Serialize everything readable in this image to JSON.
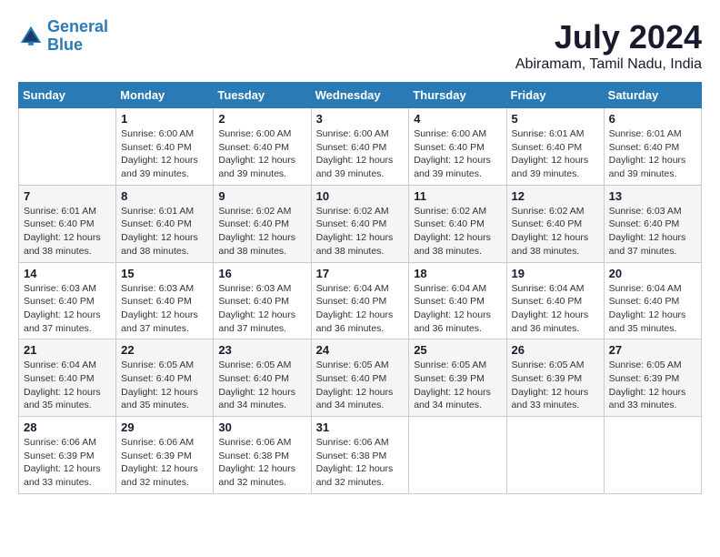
{
  "header": {
    "logo_line1": "General",
    "logo_line2": "Blue",
    "month_year": "July 2024",
    "location": "Abiramam, Tamil Nadu, India"
  },
  "calendar": {
    "days_of_week": [
      "Sunday",
      "Monday",
      "Tuesday",
      "Wednesday",
      "Thursday",
      "Friday",
      "Saturday"
    ],
    "weeks": [
      [
        {
          "day": "",
          "info": ""
        },
        {
          "day": "1",
          "info": "Sunrise: 6:00 AM\nSunset: 6:40 PM\nDaylight: 12 hours\nand 39 minutes."
        },
        {
          "day": "2",
          "info": "Sunrise: 6:00 AM\nSunset: 6:40 PM\nDaylight: 12 hours\nand 39 minutes."
        },
        {
          "day": "3",
          "info": "Sunrise: 6:00 AM\nSunset: 6:40 PM\nDaylight: 12 hours\nand 39 minutes."
        },
        {
          "day": "4",
          "info": "Sunrise: 6:00 AM\nSunset: 6:40 PM\nDaylight: 12 hours\nand 39 minutes."
        },
        {
          "day": "5",
          "info": "Sunrise: 6:01 AM\nSunset: 6:40 PM\nDaylight: 12 hours\nand 39 minutes."
        },
        {
          "day": "6",
          "info": "Sunrise: 6:01 AM\nSunset: 6:40 PM\nDaylight: 12 hours\nand 39 minutes."
        }
      ],
      [
        {
          "day": "7",
          "info": "Sunrise: 6:01 AM\nSunset: 6:40 PM\nDaylight: 12 hours\nand 38 minutes."
        },
        {
          "day": "8",
          "info": "Sunrise: 6:01 AM\nSunset: 6:40 PM\nDaylight: 12 hours\nand 38 minutes."
        },
        {
          "day": "9",
          "info": "Sunrise: 6:02 AM\nSunset: 6:40 PM\nDaylight: 12 hours\nand 38 minutes."
        },
        {
          "day": "10",
          "info": "Sunrise: 6:02 AM\nSunset: 6:40 PM\nDaylight: 12 hours\nand 38 minutes."
        },
        {
          "day": "11",
          "info": "Sunrise: 6:02 AM\nSunset: 6:40 PM\nDaylight: 12 hours\nand 38 minutes."
        },
        {
          "day": "12",
          "info": "Sunrise: 6:02 AM\nSunset: 6:40 PM\nDaylight: 12 hours\nand 38 minutes."
        },
        {
          "day": "13",
          "info": "Sunrise: 6:03 AM\nSunset: 6:40 PM\nDaylight: 12 hours\nand 37 minutes."
        }
      ],
      [
        {
          "day": "14",
          "info": "Sunrise: 6:03 AM\nSunset: 6:40 PM\nDaylight: 12 hours\nand 37 minutes."
        },
        {
          "day": "15",
          "info": "Sunrise: 6:03 AM\nSunset: 6:40 PM\nDaylight: 12 hours\nand 37 minutes."
        },
        {
          "day": "16",
          "info": "Sunrise: 6:03 AM\nSunset: 6:40 PM\nDaylight: 12 hours\nand 37 minutes."
        },
        {
          "day": "17",
          "info": "Sunrise: 6:04 AM\nSunset: 6:40 PM\nDaylight: 12 hours\nand 36 minutes."
        },
        {
          "day": "18",
          "info": "Sunrise: 6:04 AM\nSunset: 6:40 PM\nDaylight: 12 hours\nand 36 minutes."
        },
        {
          "day": "19",
          "info": "Sunrise: 6:04 AM\nSunset: 6:40 PM\nDaylight: 12 hours\nand 36 minutes."
        },
        {
          "day": "20",
          "info": "Sunrise: 6:04 AM\nSunset: 6:40 PM\nDaylight: 12 hours\nand 35 minutes."
        }
      ],
      [
        {
          "day": "21",
          "info": "Sunrise: 6:04 AM\nSunset: 6:40 PM\nDaylight: 12 hours\nand 35 minutes."
        },
        {
          "day": "22",
          "info": "Sunrise: 6:05 AM\nSunset: 6:40 PM\nDaylight: 12 hours\nand 35 minutes."
        },
        {
          "day": "23",
          "info": "Sunrise: 6:05 AM\nSunset: 6:40 PM\nDaylight: 12 hours\nand 34 minutes."
        },
        {
          "day": "24",
          "info": "Sunrise: 6:05 AM\nSunset: 6:40 PM\nDaylight: 12 hours\nand 34 minutes."
        },
        {
          "day": "25",
          "info": "Sunrise: 6:05 AM\nSunset: 6:39 PM\nDaylight: 12 hours\nand 34 minutes."
        },
        {
          "day": "26",
          "info": "Sunrise: 6:05 AM\nSunset: 6:39 PM\nDaylight: 12 hours\nand 33 minutes."
        },
        {
          "day": "27",
          "info": "Sunrise: 6:05 AM\nSunset: 6:39 PM\nDaylight: 12 hours\nand 33 minutes."
        }
      ],
      [
        {
          "day": "28",
          "info": "Sunrise: 6:06 AM\nSunset: 6:39 PM\nDaylight: 12 hours\nand 33 minutes."
        },
        {
          "day": "29",
          "info": "Sunrise: 6:06 AM\nSunset: 6:39 PM\nDaylight: 12 hours\nand 32 minutes."
        },
        {
          "day": "30",
          "info": "Sunrise: 6:06 AM\nSunset: 6:38 PM\nDaylight: 12 hours\nand 32 minutes."
        },
        {
          "day": "31",
          "info": "Sunrise: 6:06 AM\nSunset: 6:38 PM\nDaylight: 12 hours\nand 32 minutes."
        },
        {
          "day": "",
          "info": ""
        },
        {
          "day": "",
          "info": ""
        },
        {
          "day": "",
          "info": ""
        }
      ]
    ]
  }
}
